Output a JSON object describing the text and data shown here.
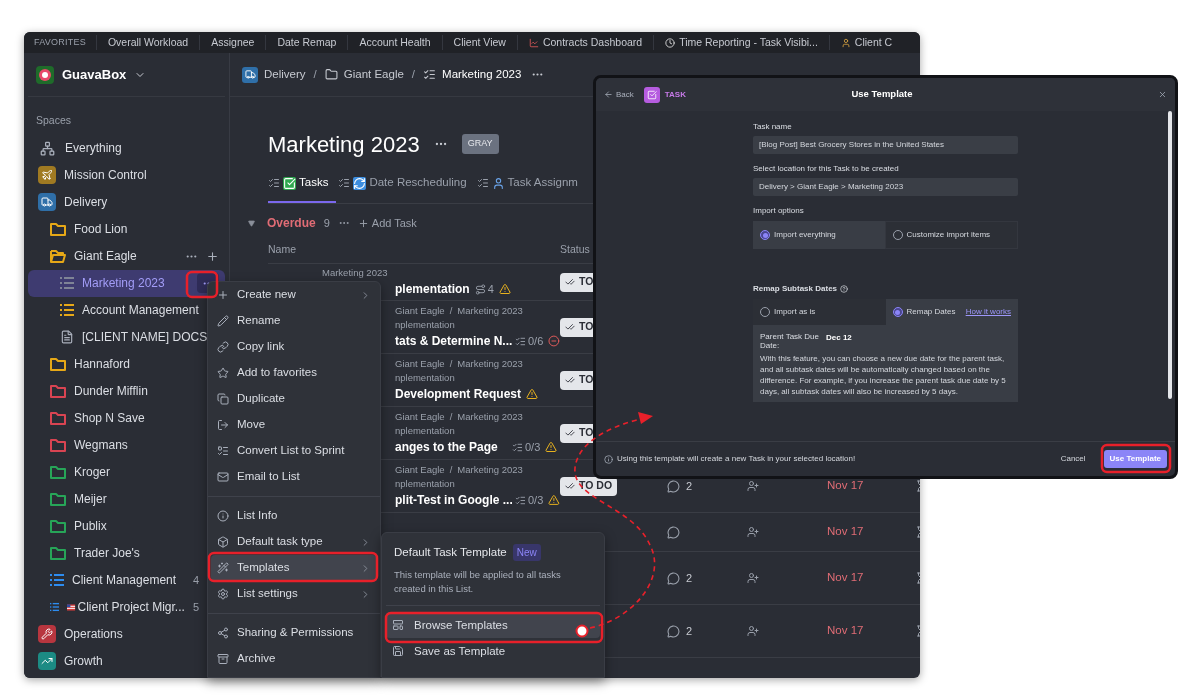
{
  "favorites_bar": {
    "label": "FAVORITES",
    "items": [
      {
        "label": "Overall Workload"
      },
      {
        "label": "Assignee"
      },
      {
        "label": "Date Remap"
      },
      {
        "label": "Account Health"
      },
      {
        "label": "Client View"
      },
      {
        "label": "Contracts Dashboard"
      },
      {
        "label": "Time Reporting - Task Visibi..."
      },
      {
        "label": "Client C"
      }
    ]
  },
  "sidebar": {
    "workspace": "GuavaBox",
    "section_label": "Spaces",
    "items": [
      {
        "label": "Everything",
        "kind": "everything",
        "selected": false
      },
      {
        "label": "Mission Control",
        "kind": "space",
        "color": "#a07a22",
        "selected": false
      },
      {
        "label": "Delivery",
        "kind": "space",
        "color": "#2f6fa8",
        "selected": false,
        "children": [
          {
            "label": "Food Lion",
            "kind": "folder",
            "color": "#e6a817",
            "selected": false
          },
          {
            "label": "Giant Eagle",
            "kind": "folder_open",
            "color": "#e6a817",
            "selected": false,
            "actions": true,
            "children": [
              {
                "label": "Marketing 2023",
                "kind": "list",
                "color": "#7f8496",
                "selected": true,
                "menu_open": true
              },
              {
                "label": "Account Management",
                "kind": "list",
                "color": "#e6a817",
                "selected": false
              },
              {
                "label": "[CLIENT NAME] DOCS",
                "kind": "doc",
                "selected": false
              }
            ]
          },
          {
            "label": "Hannaford",
            "kind": "folder",
            "color": "#e6a817",
            "selected": false
          },
          {
            "label": "Dunder Mifflin",
            "kind": "folder",
            "color": "#d94452",
            "selected": false
          },
          {
            "label": "Shop N Save",
            "kind": "folder",
            "color": "#d94452",
            "selected": false
          },
          {
            "label": "Wegmans",
            "kind": "folder",
            "color": "#d94452",
            "selected": false
          },
          {
            "label": "Kroger",
            "kind": "folder",
            "color": "#27a558",
            "selected": false
          },
          {
            "label": "Meijer",
            "kind": "folder",
            "color": "#27a558",
            "selected": false
          },
          {
            "label": "Publix",
            "kind": "folder",
            "color": "#27a558",
            "selected": false
          },
          {
            "label": "Trader Joe's",
            "kind": "folder",
            "color": "#27a558",
            "selected": false
          },
          {
            "label": "Client Management",
            "kind": "list",
            "color": "#2d8cf0",
            "count": "4",
            "selected": false
          },
          {
            "label": "Client Project Migr...",
            "kind": "list",
            "color": "#2d8cf0",
            "count": "5",
            "flag": true,
            "selected": false
          }
        ]
      },
      {
        "label": "Operations",
        "kind": "space",
        "color": "#b8363f",
        "selected": false
      },
      {
        "label": "Growth",
        "kind": "space",
        "color": "#1c8b84",
        "selected": false
      }
    ]
  },
  "main": {
    "breadcrumb": [
      {
        "label": "Delivery",
        "kind": "space"
      },
      {
        "label": "Giant Eagle",
        "kind": "folder",
        "separator": "/"
      },
      {
        "label": "Marketing 2023",
        "kind": "list",
        "separator": "/"
      }
    ],
    "title": "Marketing 2023",
    "badge": "GRAY",
    "tabs": [
      {
        "label": "Tasks",
        "selected": true
      },
      {
        "label": "Date Rescheduling",
        "selected": false
      },
      {
        "label": "Task Assignm",
        "selected": false
      }
    ],
    "group": {
      "name": "Overdue",
      "count": "9",
      "add_label": "Add Task"
    },
    "columns": [
      "Name",
      "Status"
    ],
    "rows": [
      {
        "path": [
          {
            "label": "Marketing 2023"
          }
        ],
        "name": "plementation",
        "links": "4",
        "warning": true,
        "status": "TO"
      },
      {
        "path": [
          {
            "label": "Giant Eagle"
          },
          {
            "label": "Marketing 2023",
            "separator": "/"
          }
        ],
        "subpath": "nplementation",
        "name": "tats & Determine N...",
        "subtasks": "0/6",
        "blocked": true,
        "status": "TO"
      },
      {
        "path": [
          {
            "label": "Giant Eagle"
          },
          {
            "label": "Marketing 2023",
            "separator": "/"
          }
        ],
        "subpath": "nplementation",
        "name": "Development Request",
        "warning": true,
        "status": "TO"
      },
      {
        "path": [
          {
            "label": "Giant Eagle"
          },
          {
            "label": "Marketing 2023",
            "separator": "/"
          }
        ],
        "subpath": "nplementation",
        "name": "anges to the Page",
        "subtasks": "0/3",
        "warning": true,
        "status": "TO"
      },
      {
        "path": [
          {
            "label": "Giant Eagle"
          },
          {
            "label": "Marketing 2023",
            "separator": "/"
          }
        ],
        "subpath": "nplementation",
        "name": "plit-Test in Google ...",
        "subtasks": "0/3",
        "warning": true,
        "status": "TO DO",
        "comments": "2",
        "date": "Nov 17"
      },
      {
        "date": "Nov 17"
      },
      {
        "comments": "2",
        "date": "Nov 17"
      },
      {
        "comments": "2",
        "date": "Nov 17"
      }
    ]
  },
  "context_menu": {
    "sections": [
      [
        {
          "label": "Create new",
          "submenu": true,
          "selected": false
        },
        {
          "label": "Rename",
          "submenu": false,
          "selected": false
        },
        {
          "label": "Copy link",
          "submenu": false,
          "selected": false
        },
        {
          "label": "Add to favorites",
          "submenu": false,
          "selected": false
        },
        {
          "label": "Duplicate",
          "submenu": false,
          "selected": false
        },
        {
          "label": "Move",
          "submenu": false,
          "selected": false
        },
        {
          "label": "Convert List to Sprint",
          "submenu": false,
          "selected": false
        },
        {
          "label": "Email to List",
          "submenu": false,
          "selected": false
        }
      ],
      [
        {
          "label": "List Info",
          "submenu": false,
          "selected": false
        },
        {
          "label": "Default task type",
          "submenu": true,
          "selected": false
        },
        {
          "label": "Templates",
          "submenu": true,
          "selected": true
        },
        {
          "label": "List settings",
          "submenu": true,
          "selected": false
        }
      ],
      [
        {
          "label": "Sharing & Permissions",
          "submenu": false,
          "selected": false
        },
        {
          "label": "Archive",
          "submenu": false,
          "selected": false
        }
      ]
    ]
  },
  "submenu": {
    "title": "Default Task Template",
    "badge": "New",
    "description": "This template will be applied to all tasks created in this List.",
    "items": [
      {
        "label": "Browse Templates",
        "selected": true
      },
      {
        "label": "Save as Template",
        "selected": false
      }
    ]
  },
  "dialog": {
    "back_label": "Back",
    "type_label": "TASK",
    "title": "Use Template",
    "fields": [
      {
        "label": "Task name",
        "value": "[Blog Post] Best Grocery Stores in the United States"
      },
      {
        "label": "Select location for this Task to be created",
        "value": "Delivery > Giant Eagle > Marketing 2023"
      }
    ],
    "import_options": {
      "label": "Import options",
      "options": [
        {
          "label": "Import everything",
          "selected": true
        },
        {
          "label": "Customize import items",
          "selected": false
        }
      ]
    },
    "remap": {
      "label": "Remap Subtask Dates",
      "options": [
        {
          "label": "Import as is",
          "selected": false
        },
        {
          "label": "Remap Dates",
          "selected": true
        }
      ],
      "link": "How it works",
      "due_label": "Parent Task Due Date:",
      "due_value": "Dec 12",
      "description": "With this feature, you can choose a new due date for the parent task, and all subtask dates will be automatically changed based on the difference. For example, if you increase the parent task due date by 5 days, all subtask dates will also be increased by 5 days."
    },
    "footer_note": "Using this template will create a new Task in your selected location!",
    "cancel": "Cancel",
    "confirm": "Use Template"
  }
}
